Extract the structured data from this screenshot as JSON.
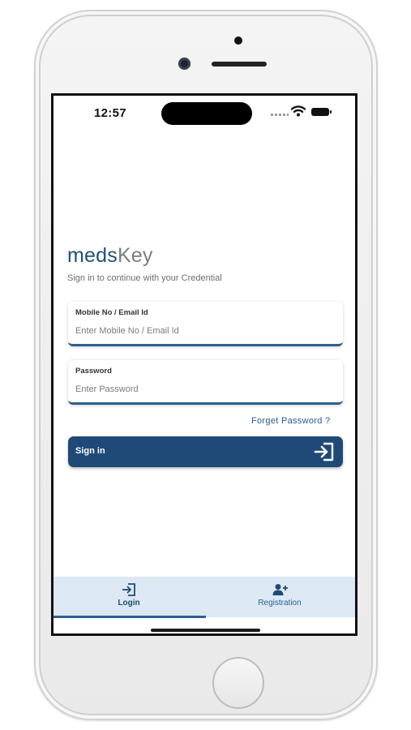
{
  "status_bar": {
    "time": "12:57"
  },
  "brand": {
    "part1": "meds",
    "part2": "Key"
  },
  "subtitle": "Sign in to continue with your Credential",
  "login_form": {
    "mobile": {
      "label": "Mobile No / Email Id",
      "placeholder": "Enter Mobile No / Email Id",
      "value": ""
    },
    "password": {
      "label": "Password",
      "placeholder": "Enter Password",
      "value": ""
    },
    "forgot_label": "Forget Password ?",
    "signin_label": "Sign in",
    "signin_icon": "login-arrow-icon"
  },
  "tabs": [
    {
      "label": "Login",
      "icon": "login-icon",
      "active": true
    },
    {
      "label": "Registration",
      "icon": "add-user-icon",
      "active": false
    }
  ],
  "colors": {
    "primary": "#1f4a77",
    "brand_blue": "#1f4f7c",
    "brand_gray": "#7d7d7d",
    "tabbar_bg": "#dce9f5"
  }
}
